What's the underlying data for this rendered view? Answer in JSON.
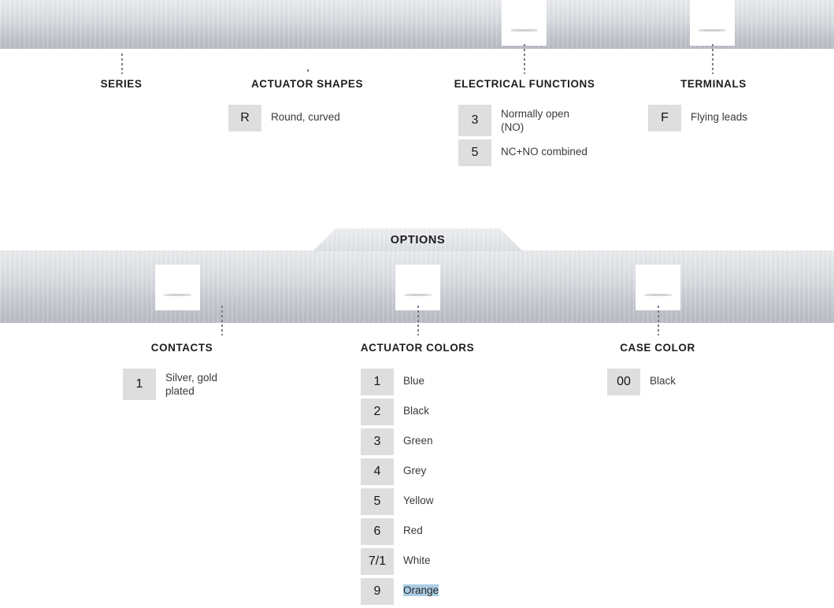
{
  "bands": {
    "top_band_name": "top-metal-band",
    "options_band_name": "options-metal-band"
  },
  "options_banner": {
    "label": "OPTIONS"
  },
  "top_section": {
    "columns": [
      {
        "key": "series",
        "title": "SERIES",
        "options": []
      },
      {
        "key": "actuator_shapes",
        "title": "ACTUATOR SHAPES",
        "options": [
          {
            "code": "R",
            "desc": "Round, curved"
          }
        ]
      },
      {
        "key": "electrical_functions",
        "title": "ELECTRICAL FUNCTIONS",
        "options": [
          {
            "code": "3",
            "desc": "Normally open\n(NO)"
          },
          {
            "code": "5",
            "desc": "NC+NO combined"
          }
        ]
      },
      {
        "key": "terminals",
        "title": "TERMINALS",
        "options": [
          {
            "code": "F",
            "desc": "Flying leads"
          }
        ]
      }
    ]
  },
  "options_section": {
    "columns": [
      {
        "key": "contacts",
        "title": "CONTACTS",
        "options": [
          {
            "code": "1",
            "desc": "Silver, gold\nplated"
          }
        ]
      },
      {
        "key": "actuator_colors",
        "title": "ACTUATOR COLORS",
        "options": [
          {
            "code": "1",
            "desc": "Blue"
          },
          {
            "code": "2",
            "desc": "Black"
          },
          {
            "code": "3",
            "desc": "Green"
          },
          {
            "code": "4",
            "desc": "Grey"
          },
          {
            "code": "5",
            "desc": "Yellow"
          },
          {
            "code": "6",
            "desc": "Red"
          },
          {
            "code": "7/1",
            "desc": "White"
          },
          {
            "code": "9",
            "desc": "Orange",
            "selected": true
          }
        ]
      },
      {
        "key": "case_color",
        "title": "CASE COLOR",
        "options": [
          {
            "code": "00",
            "desc": "Black"
          }
        ]
      }
    ]
  },
  "selection": {
    "highlighted_text": "Orange",
    "highlight_color": "#a9cce3"
  },
  "palette": {
    "code_badge_bg": "#dedede",
    "band_light": "#e9eaec",
    "band_dark": "#b7bac1",
    "text": "#2a2a2a"
  }
}
